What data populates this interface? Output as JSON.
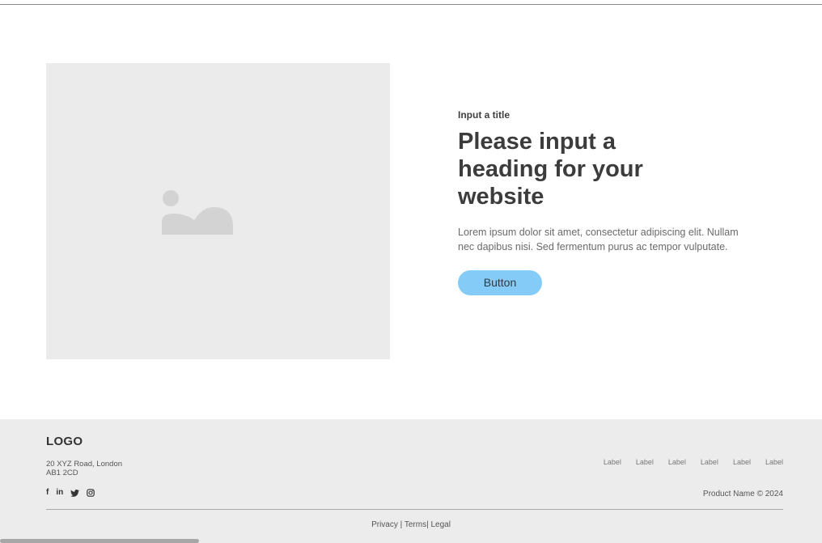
{
  "hero": {
    "eyebrow": "Input a title",
    "heading": "Please input a heading for your website",
    "body": "Lorem ipsum dolor sit amet, consectetur adipiscing elit. Nullam nec dapibus nisi. Sed fermentum purus ac tempor vulputate.",
    "button_label": "Button",
    "image_icon": "image-placeholder-icon",
    "button_color": "#84ccf7"
  },
  "footer": {
    "logo": "LOGO",
    "address_line1": "20 XYZ Road, London",
    "address_line2": "AB1 2CD",
    "social": {
      "facebook": "f",
      "linkedin": "in",
      "twitter": "twitter-icon",
      "instagram": "instagram-icon"
    },
    "links": [
      "Label",
      "Label",
      "Label",
      "Label",
      "Label",
      "Label"
    ],
    "copyright": "Product Name © 2024",
    "legal": {
      "privacy": "Privacy",
      "sep1": " | ",
      "terms": "Terms",
      "sep2": "| ",
      "legal": "Legal"
    },
    "background": "#ececec"
  }
}
